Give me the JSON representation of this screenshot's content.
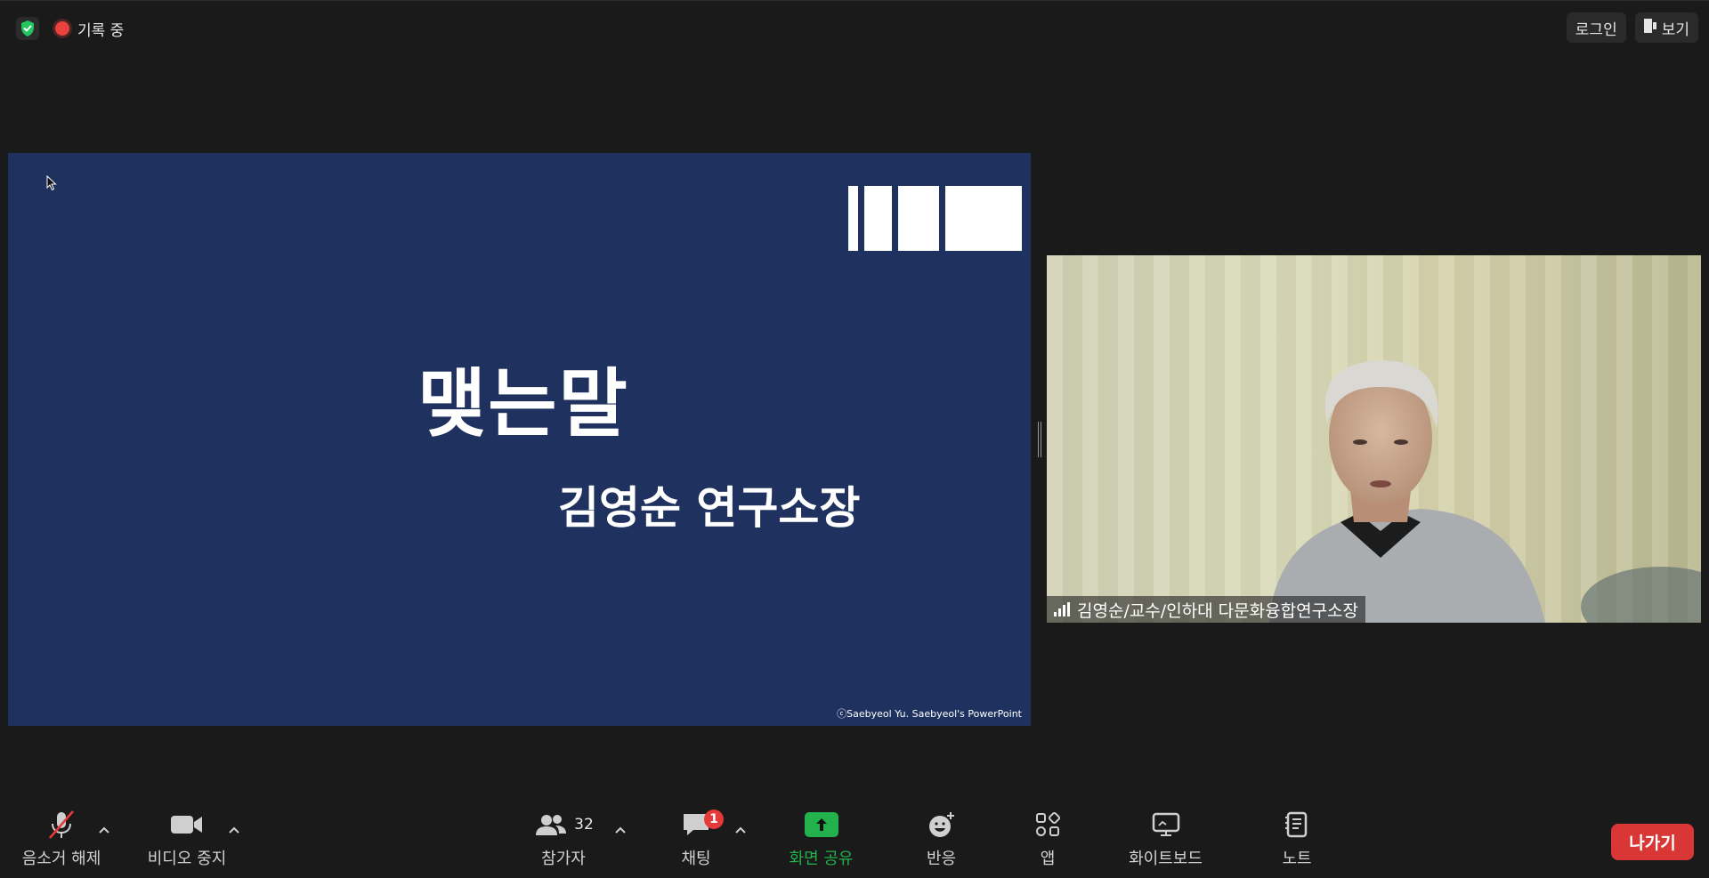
{
  "topbar": {
    "recording_label": "기록 중",
    "login_label": "로그인",
    "view_label": "보기"
  },
  "slide": {
    "title": "맺는말",
    "subtitle": "김영순 연구소장",
    "credit": "ⓒSaebyeol Yu. Saebyeol's PowerPoint"
  },
  "video": {
    "participant_name": "김영순/교수/인하대 다문화융합연구소장"
  },
  "toolbar": {
    "mute_label": "음소거 해제",
    "video_label": "비디오 중지",
    "participants_label": "참가자",
    "participants_count": "32",
    "chat_label": "채팅",
    "chat_badge": "1",
    "share_label": "화면 공유",
    "reactions_label": "반응",
    "apps_label": "앱",
    "whiteboard_label": "화이트보드",
    "notes_label": "노트",
    "leave_label": "나가기"
  },
  "colors": {
    "background": "#1a1a1a",
    "slide_bg": "#1f325f",
    "share_green": "#22b14c",
    "leave_red": "#d93636",
    "rec_red": "#e8423a",
    "shield_green": "#22c55e"
  },
  "icons": [
    "shield-check-icon",
    "record-icon",
    "view-icon",
    "mic-muted-icon",
    "video-camera-icon",
    "participants-icon",
    "chat-icon",
    "share-screen-icon",
    "reaction-icon",
    "apps-icon",
    "whiteboard-icon",
    "notes-icon",
    "chevron-up-icon",
    "signal-icon",
    "mouse-pointer-icon"
  ]
}
